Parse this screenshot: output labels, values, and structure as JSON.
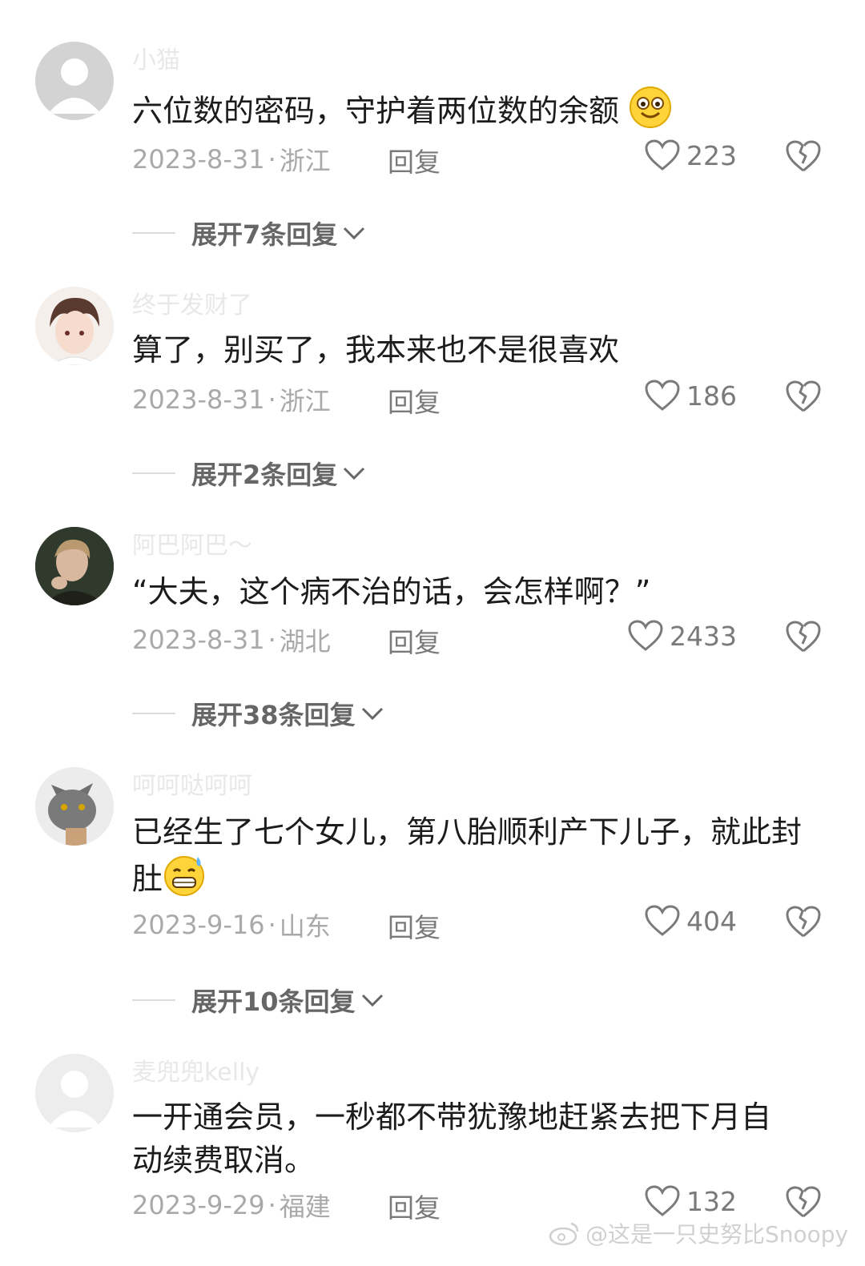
{
  "comments": [
    {
      "username": "小猫",
      "text": "六位数的密码，守护着两位数的余额",
      "emoji": "smiling-face-emoji",
      "date": "2023-8-31",
      "location": "浙江",
      "reply_label": "回复",
      "likes": "223",
      "expand_label": "展开7条回复"
    },
    {
      "username": "终于发财了",
      "text": "算了，别买了，我本来也不是很喜欢",
      "date": "2023-8-31",
      "location": "浙江",
      "reply_label": "回复",
      "likes": "186",
      "expand_label": "展开2条回复"
    },
    {
      "username": "阿巴阿巴～",
      "text": "“大夫，这个病不治的话，会怎样啊？”",
      "date": "2023-8-31",
      "location": "湖北",
      "reply_label": "回复",
      "likes": "2433",
      "expand_label": "展开38条回复"
    },
    {
      "username": "呵呵哒呵呵",
      "text": "已经生了七个女儿，第八胎顺利产下儿子，就此封肚",
      "emoji": "grimacing-sweat-emoji",
      "date": "2023-9-16",
      "location": "山东",
      "reply_label": "回复",
      "likes": "404",
      "expand_label": "展开10条回复"
    },
    {
      "username": "麦兜兜kelly",
      "text": "一开通会员，一秒都不带犹豫地赶紧去把下月自动续费取消。",
      "date": "2023-9-29",
      "location": "福建",
      "reply_label": "回复",
      "likes": "132"
    }
  ],
  "watermark": "@这是一只史努比Snoopy",
  "icons": {
    "like": "heart-outline-icon",
    "dislike": "broken-heart-icon",
    "expand": "chevron-down-icon",
    "watermark": "weibo-logo-icon"
  },
  "colors": {
    "text": "#1c1c1c",
    "meta": "#a9a9a9",
    "action": "#7a7a7a",
    "username": "#e8e8e8"
  }
}
